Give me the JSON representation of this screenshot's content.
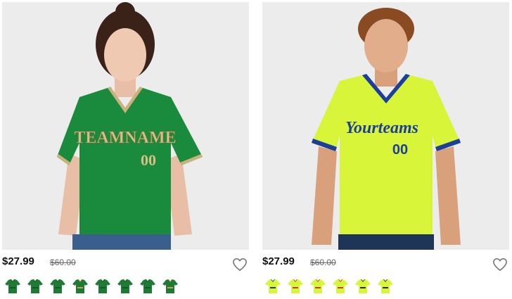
{
  "products": [
    {
      "price": "$27.99",
      "old_price": "$60.00",
      "jersey_text": "TEAMNAME",
      "jersey_number": "00",
      "jersey_color": "#1a8a3c",
      "trim_color": "#c9b27c",
      "wishlist_icon": "heart-outline-icon",
      "swatches": [
        {
          "body": "#1f7a36",
          "trim": "#0f5a25"
        },
        {
          "body": "#1f7a36",
          "trim": "#0f5a25"
        },
        {
          "body": "#1f7a36",
          "trim": "#0f5a25"
        },
        {
          "body": "#1f7a36",
          "trim": "#c9a14a"
        },
        {
          "body": "#1f7a36",
          "trim": "#0f5a25"
        },
        {
          "body": "#1f7a36",
          "trim": "#0f5a25"
        },
        {
          "body": "#1f7a36",
          "trim": "#0f5a25"
        },
        {
          "body": "#1f7a36",
          "trim": "#c9a14a"
        }
      ]
    },
    {
      "price": "$27.99",
      "old_price": "$60.00",
      "jersey_text": "Yourteams",
      "jersey_number": "00",
      "jersey_color": "#d9f53a",
      "trim_color": "#1b3f9a",
      "wishlist_icon": "heart-outline-icon",
      "swatches": [
        {
          "body": "#d9f53a",
          "trim": "#1b3f9a"
        },
        {
          "body": "#d9f53a",
          "trim": "#c23b2a"
        },
        {
          "body": "#d9f53a",
          "trim": "#c23b2a"
        },
        {
          "body": "#d9f53a",
          "trim": "#c23b2a"
        },
        {
          "body": "#d9f53a",
          "trim": "#2e2e2e"
        },
        {
          "body": "#d9f53a",
          "trim": "#2e2e2e"
        }
      ]
    }
  ]
}
